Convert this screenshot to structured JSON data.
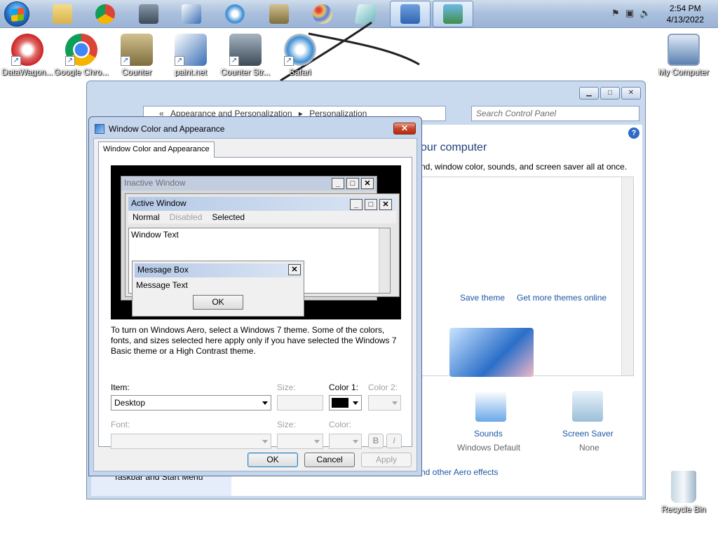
{
  "taskbar": {
    "start_icon": "windows-start-orb",
    "apps": [
      {
        "name": "windows-explorer-icon",
        "color": "#e6c35a"
      },
      {
        "name": "chrome-icon",
        "color": "#db4437"
      },
      {
        "name": "counter-strike-icon",
        "color": "#506070"
      },
      {
        "name": "paint-net-icon",
        "color": "#3a6fb5"
      },
      {
        "name": "safari-icon",
        "color": "#3d8fd6"
      },
      {
        "name": "counter-strike-soldier-icon",
        "color": "#9a8a55"
      },
      {
        "name": "paint-palette-icon",
        "color": "#c8a060"
      },
      {
        "name": "notepad-icon",
        "color": "#8fc4c8"
      },
      {
        "name": "control-panel-icon",
        "color": "#4a7fc0"
      },
      {
        "name": "window-color-icon",
        "color": "#3e8f4a"
      }
    ],
    "clock_time": "2:54 PM",
    "clock_date": "4/13/2022"
  },
  "desktop": {
    "icons": [
      {
        "label": "DataWagon...",
        "icon": "datawagon-icon",
        "color": "#d13a3a"
      },
      {
        "label": "Google Chro...",
        "icon": "chrome-icon",
        "color": "#db4437"
      },
      {
        "label": "Counter",
        "icon": "counter-icon",
        "color": "#9a8a55"
      },
      {
        "label": "paint.net",
        "icon": "paint-net-icon",
        "color": "#3a6fb5"
      },
      {
        "label": "Counter Str...",
        "icon": "counter-strike-icon",
        "color": "#506070"
      },
      {
        "label": "Safari",
        "icon": "safari-icon",
        "color": "#3d8fd6"
      },
      {
        "label": "My Computer",
        "icon": "computer-icon",
        "color": "#5a7fb0"
      },
      {
        "label": "Recycle Bin",
        "icon": "recycle-bin-icon",
        "color": "#9fb6c9"
      }
    ]
  },
  "control_panel": {
    "breadcrumb_root": "«",
    "breadcrumb_1": "Appearance and Personalization",
    "breadcrumb_sep": "▸",
    "breadcrumb_2": "Personalization",
    "search_placeholder": "Search Control Panel",
    "heading_partial": "our computer",
    "subheading_partial": "nd, window color, sounds, and screen saver all at once.",
    "save_theme": "Save theme",
    "more_themes": "Get more themes online",
    "sounds_label": "Sounds",
    "sounds_value": "Windows Default",
    "screensaver_label": "Screen Saver",
    "screensaver_value": "None",
    "aero_link": "nd other Aero effects",
    "taskbar_link": "Taskbar and Start Menu"
  },
  "dialog": {
    "title": "Window Color and Appearance",
    "close_glyph": "✕",
    "tab_label": "Window Color and Appearance",
    "preview": {
      "inactive_title": "Inactive Window",
      "active_title": "Active Window",
      "menu_normal": "Normal",
      "menu_disabled": "Disabled",
      "menu_selected": "Selected",
      "window_text": "Window Text",
      "msgbox_title": "Message Box",
      "msgbox_text": "Message Text",
      "msgbox_ok": "OK"
    },
    "note": "To turn on Windows Aero, select a Windows 7 theme.  Some of the colors, fonts, and sizes selected here apply only if you have selected the Windows 7 Basic theme or a High Contrast theme.",
    "item_label": "Item:",
    "item_value": "Desktop",
    "size_label": "Size:",
    "color1_label": "Color 1:",
    "color1_value": "#000000",
    "color2_label": "Color 2:",
    "font_label": "Font:",
    "font_size_label": "Size:",
    "font_color_label": "Color:",
    "bold_label": "B",
    "italic_label": "I",
    "ok": "OK",
    "cancel": "Cancel",
    "apply": "Apply"
  }
}
